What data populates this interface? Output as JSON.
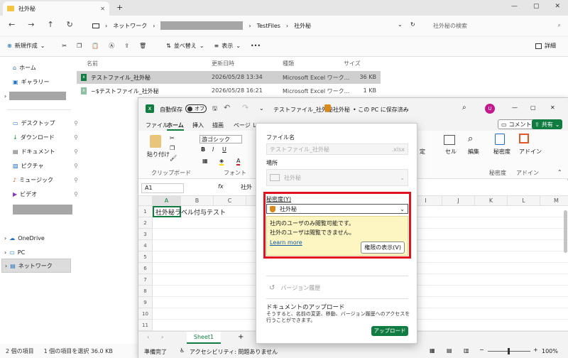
{
  "explorer": {
    "tab_title": "社外秘",
    "path": [
      "ネットワーク",
      "TestFiles",
      "社外秘"
    ],
    "search_placeholder": "社外秘の検索",
    "cmd": {
      "new": "新規作成",
      "sort": "並べ替え",
      "view": "表示",
      "more": "•••",
      "details": "詳細"
    },
    "sidebar": [
      {
        "icon": "home-icon",
        "label": "ホーム"
      },
      {
        "icon": "gallery-icon",
        "label": "ギャラリー"
      },
      {
        "icon": "desktop-icon",
        "label": "デスクトップ"
      },
      {
        "icon": "download-icon",
        "label": "ダウンロード"
      },
      {
        "icon": "documents-icon",
        "label": "ドキュメント"
      },
      {
        "icon": "pictures-icon",
        "label": "ピクチャ"
      },
      {
        "icon": "music-icon",
        "label": "ミュージック"
      },
      {
        "icon": "video-icon",
        "label": "ビデオ"
      },
      {
        "icon": "onedrive-icon",
        "label": "OneDrive"
      },
      {
        "icon": "pc-icon",
        "label": "PC"
      },
      {
        "icon": "network-icon",
        "label": "ネットワーク"
      }
    ],
    "columns": [
      "名前",
      "更新日時",
      "種類",
      "サイズ"
    ],
    "files": [
      {
        "name": "テストファイル_社外秘",
        "date": "2026/05/28 13:34",
        "type": "Microsoft Excel ワーク...",
        "size": "36 KB"
      },
      {
        "name": "~$テストファイル_社外秘",
        "date": "2026/05/28 16:21",
        "type": "Microsoft Excel ワーク...",
        "size": "1 KB"
      }
    ],
    "status": {
      "count": "2 個の項目",
      "selected": "1 個の項目を選択 36.0 KB"
    }
  },
  "excel": {
    "autosave": "自動保存",
    "autosave_state": "オフ",
    "doc_title": "テストファイル_社外秘",
    "label_name": "社外秘",
    "saved_state": "• この PC に保存済み",
    "avatar_letter": "U",
    "comment": "コメント",
    "share": "共有",
    "tabs": [
      "ファイル",
      "ホーム",
      "挿入",
      "描画",
      "ページ レ"
    ],
    "ribbon": {
      "paste": "貼り付け",
      "clipboard": "クリップボード",
      "font_name": "游ゴシック",
      "font": "フォント",
      "cell": "セル",
      "edit": "編集",
      "sensitivity": "秘密度",
      "sensitivity_group": "秘密度",
      "addin": "アドイン",
      "addin_group": "アドイン",
      "format_partial": "定"
    },
    "name_box": "A1",
    "fx": "fx",
    "formula_value": "社外",
    "columns": [
      "A",
      "B",
      "C",
      "D",
      "E",
      "F",
      "G",
      "H",
      "I",
      "J",
      "K",
      "L",
      "M"
    ],
    "rows": [
      "1",
      "2",
      "3",
      "4",
      "5",
      "6",
      "7",
      "8",
      "9",
      "10",
      "11"
    ],
    "cell_a1": "社外秘ラベル付与テスト",
    "sheet": "Sheet1",
    "status_ready": "準備完了",
    "accessibility": "アクセシビリティ: 問題ありません",
    "zoom": "100%"
  },
  "popup": {
    "filename_label": "ファイル名",
    "filename_value": "テストファイル_社外秘",
    "ext": ".xlsx",
    "location_label": "場所",
    "location_value": "社外秘",
    "sensitivity_label": "秘密度(Y)",
    "sensitivity_value": "社外秘",
    "info_line1": "社内のユーザのみ閲覧可能です。",
    "info_line2": "社外のユーザは閲覧できません。",
    "learn_more": "Learn more",
    "permissions_button": "権限の表示(V)",
    "version_history": "バージョン履歴",
    "upload_title": "ドキュメントのアップロード",
    "upload_desc": "そうすると、名前の変更、移動、バージョン履歴へのアクセスを行うことができます。",
    "upload_button": "アップロード"
  },
  "colors": {
    "excel_green": "#107c41",
    "highlight_red": "#e0141e",
    "info_yellow": "#fdf6c3"
  }
}
